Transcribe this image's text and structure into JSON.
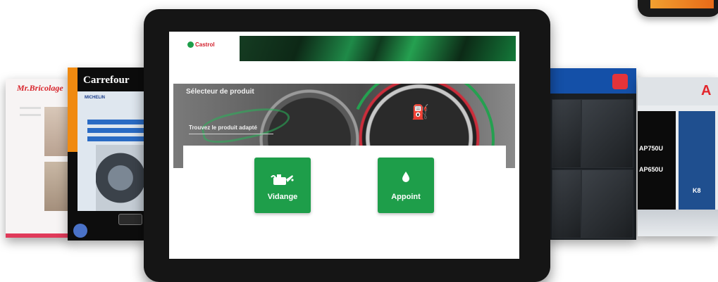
{
  "tablet_app": {
    "brand": "Castrol",
    "hero": {
      "title": "Sélecteur de produit",
      "subtitle": "Trouvez le produit adapté"
    },
    "actions": [
      {
        "label": "Vidange",
        "icon": "oil-can-icon"
      },
      {
        "label": "Appoint",
        "icon": "drop-icon"
      }
    ],
    "colors": {
      "accent": "#1e9e4a",
      "brand_red": "#d21f2b"
    }
  },
  "background_cards": {
    "mr_bricolage": {
      "logo": "Mr.Bricolage"
    },
    "carrefour": {
      "logo": "Carrefour",
      "partner": "MICHELIN"
    },
    "car_parts": {},
    "auchan": {
      "logo": "A",
      "products": [
        "AP750U",
        "AP650U"
      ],
      "badge": "K8"
    }
  }
}
